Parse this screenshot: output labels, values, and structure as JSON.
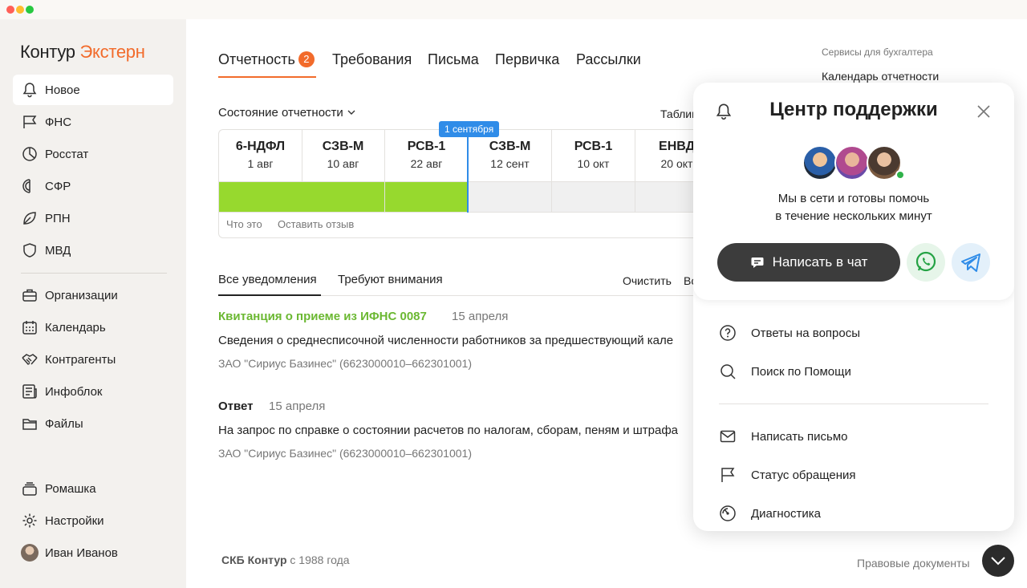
{
  "window": {
    "dots": [
      "#ff5f57",
      "#febc2e",
      "#28c840"
    ]
  },
  "logo": {
    "part1": "Контур",
    "part2": "Экстерн"
  },
  "sidebar": {
    "items": [
      {
        "label": "Новое",
        "icon": "bell-icon"
      },
      {
        "label": "ФНС",
        "icon": "flag-icon"
      },
      {
        "label": "Росстат",
        "icon": "pie-chart-icon"
      },
      {
        "label": "СФР",
        "icon": "sfr-icon"
      },
      {
        "label": "РПН",
        "icon": "leaf-icon"
      },
      {
        "label": "МВД",
        "icon": "shield-icon"
      },
      {
        "label": "Организации",
        "icon": "briefcase-icon"
      },
      {
        "label": "Календарь",
        "icon": "calendar-icon"
      },
      {
        "label": "Контрагенты",
        "icon": "handshake-icon"
      },
      {
        "label": "Инфоблок",
        "icon": "news-icon"
      },
      {
        "label": "Файлы",
        "icon": "folder-icon"
      }
    ],
    "org": "Ромашка",
    "settings": "Настройки",
    "user": "Иван Иванов"
  },
  "tabs": {
    "reporting": "Отчетность",
    "reporting_badge": "2",
    "requirements": "Требования",
    "letters": "Письма",
    "primary": "Первичка",
    "mailings": "Рассылки"
  },
  "services": {
    "heading": "Сервисы для бухгалтера",
    "calendar": "Календарь отчетности"
  },
  "status": {
    "selector": "Состояние отчетности",
    "table_link": "Таблиц"
  },
  "timeline": {
    "today": "1 сентября",
    "reports": [
      {
        "name": "6-НДФЛ",
        "date": "1 авг",
        "done": true
      },
      {
        "name": "СЗВ-М",
        "date": "10 авг",
        "done": true
      },
      {
        "name": "РСВ-1",
        "date": "22 авг",
        "done": true
      },
      {
        "name": "СЗВ-М",
        "date": "12 сент",
        "done": false
      },
      {
        "name": "РСВ-1",
        "date": "10 окт",
        "done": false
      },
      {
        "name": "ЕНВД",
        "date": "20 окт",
        "done": false
      }
    ],
    "what_is_it": "Что это",
    "feedback": "Оставить отзыв"
  },
  "notifications": {
    "tab_all": "Все уведомления",
    "tab_attention": "Требуют внимания",
    "clear": "Очистить",
    "more": "Вс",
    "items": [
      {
        "title": "Квитанция о приеме из ИФНС 0087",
        "date": "15 апреля",
        "text": "Сведения о среднесписочной численности работников за предшествующий кале",
        "org": "ЗАО \"Сириус Базинес\" (6623000010–662301001)"
      },
      {
        "title": "Ответ",
        "date": "15 апреля",
        "text": "На запрос по справке о состоянии расчетов по налогам, сборам, пеням и штрафа",
        "org": "ЗАО \"Сириус Базинес\" (6623000010–662301001)"
      }
    ]
  },
  "footer": {
    "company": "СКБ Контур",
    "since": " с 1988 года",
    "legal": "Правовые документы"
  },
  "support": {
    "title": "Центр поддержки",
    "subtitle_line1": "Мы в сети и готовы помочь",
    "subtitle_line2": "в течение нескольких минут",
    "chat_button": "Написать в чат",
    "menu": [
      {
        "label": "Ответы на вопросы",
        "icon": "question-icon"
      },
      {
        "label": "Поиск по Помощи",
        "icon": "search-icon"
      },
      {
        "label": "Написать письмо",
        "icon": "mail-icon"
      },
      {
        "label": "Статус обращения",
        "icon": "flag-icon"
      },
      {
        "label": "Диагностика",
        "icon": "diagnostics-icon"
      }
    ]
  },
  "colors": {
    "accent": "#f26b2b",
    "done": "#97d92e",
    "today": "#2f8ce8",
    "green_title": "#6bb832"
  }
}
